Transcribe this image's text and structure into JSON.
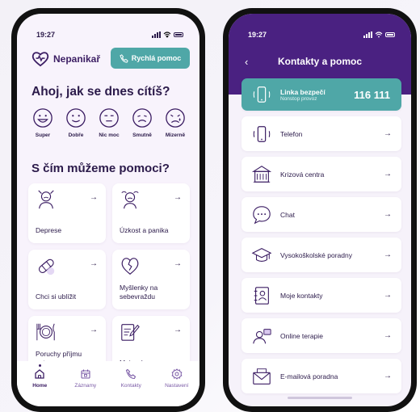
{
  "colors": {
    "primary": "#3b1d63",
    "accent": "#4fa7a7",
    "header": "#4a2181"
  },
  "left": {
    "time": "19:27",
    "brand": "Nepanikař",
    "quick_help": "Rychlá pomoc",
    "greeting": "Ahoj, jak se dnes cítíš?",
    "moods": [
      {
        "label": "Super",
        "icon": "very-happy-face-icon"
      },
      {
        "label": "Dobře",
        "icon": "happy-face-icon"
      },
      {
        "label": "Nic moc",
        "icon": "neutral-face-icon"
      },
      {
        "label": "Smutně",
        "icon": "sad-face-icon"
      },
      {
        "label": "Mizerně",
        "icon": "crying-face-icon"
      }
    ],
    "help_title": "S čím můžeme pomoci?",
    "cards": [
      {
        "label": "Deprese",
        "icon": "depressed-person-icon"
      },
      {
        "label": "Úzkost a panika",
        "icon": "anxious-person-icon"
      },
      {
        "label": "Chci si ublížit",
        "icon": "bandage-icon"
      },
      {
        "label": "Myšlenky na sebevraždu",
        "icon": "broken-heart-icon"
      },
      {
        "label": "Poruchy příjmu potravy",
        "icon": "plate-cutlery-icon"
      },
      {
        "label": "Moje záznamy",
        "icon": "notepad-pencil-icon"
      }
    ],
    "tabs": [
      {
        "label": "Home",
        "icon": "home-icon"
      },
      {
        "label": "Záznamy",
        "icon": "calendar-icon"
      },
      {
        "label": "Kontakty",
        "icon": "phone-icon"
      },
      {
        "label": "Nastavení",
        "icon": "gear-icon"
      }
    ]
  },
  "right": {
    "time": "19:27",
    "title": "Kontakty a pomoc",
    "hotline": {
      "label": "Linka bezpečí",
      "sub": "Nonstop provoz",
      "number": "116 111"
    },
    "items": [
      {
        "label": "Telefon",
        "icon": "phone-ringing-icon"
      },
      {
        "label": "Krizová centra",
        "icon": "building-icon"
      },
      {
        "label": "Chat",
        "icon": "chat-bubble-icon"
      },
      {
        "label": "Vysokoškolské poradny",
        "icon": "graduation-cap-icon"
      },
      {
        "label": "Moje kontakty",
        "icon": "address-book-icon"
      },
      {
        "label": "Online terapie",
        "icon": "video-call-icon"
      },
      {
        "label": "E-mailová poradna",
        "icon": "envelope-icon"
      }
    ]
  }
}
